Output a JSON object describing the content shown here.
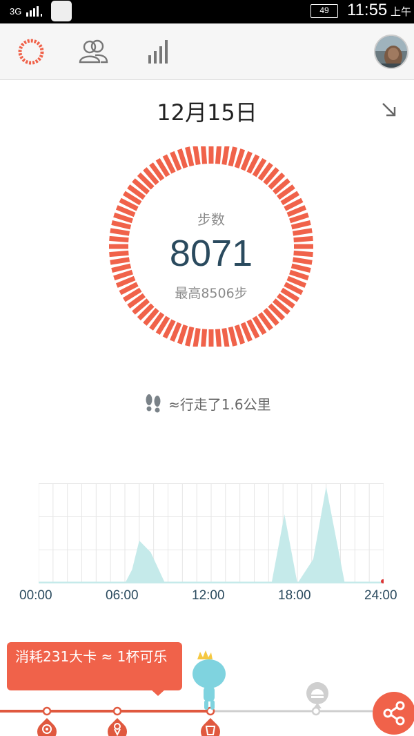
{
  "status_bar": {
    "network": "3G",
    "battery": "49",
    "time": "11:55",
    "ampm": "上午"
  },
  "toolbar": {
    "icons": [
      "ring-progress-icon",
      "friends-icon",
      "bar-stats-icon",
      "avatar"
    ]
  },
  "day": {
    "date": "12月15日"
  },
  "steps": {
    "label": "步数",
    "value": "8071",
    "best": "最高8506步",
    "progress": 1.0
  },
  "distance": {
    "text": "≈行走了1.6公里"
  },
  "chart_data": {
    "type": "area",
    "x_ticks": [
      "00:00",
      "06:00",
      "12:00",
      "18:00",
      "24:00"
    ],
    "x": [
      0,
      6,
      6.5,
      7,
      7.8,
      8.8,
      9,
      15.5,
      16.2,
      17.1,
      18.0,
      19.1,
      20.0,
      21.3,
      21.5,
      24
    ],
    "values": [
      0,
      0,
      20,
      62,
      45,
      0,
      0,
      0,
      0,
      100,
      0,
      35,
      140,
      0,
      0,
      0
    ],
    "ylim": [
      0,
      140
    ],
    "colors": {
      "fill": "#c5eaea",
      "grid": "#e6e6e6"
    }
  },
  "calorie": {
    "text": "消耗231大卡 ≈ 1杯可乐"
  },
  "colors": {
    "accent": "#f0624a",
    "text_dark": "#2a4a5e",
    "muted": "#8a8a8a"
  }
}
